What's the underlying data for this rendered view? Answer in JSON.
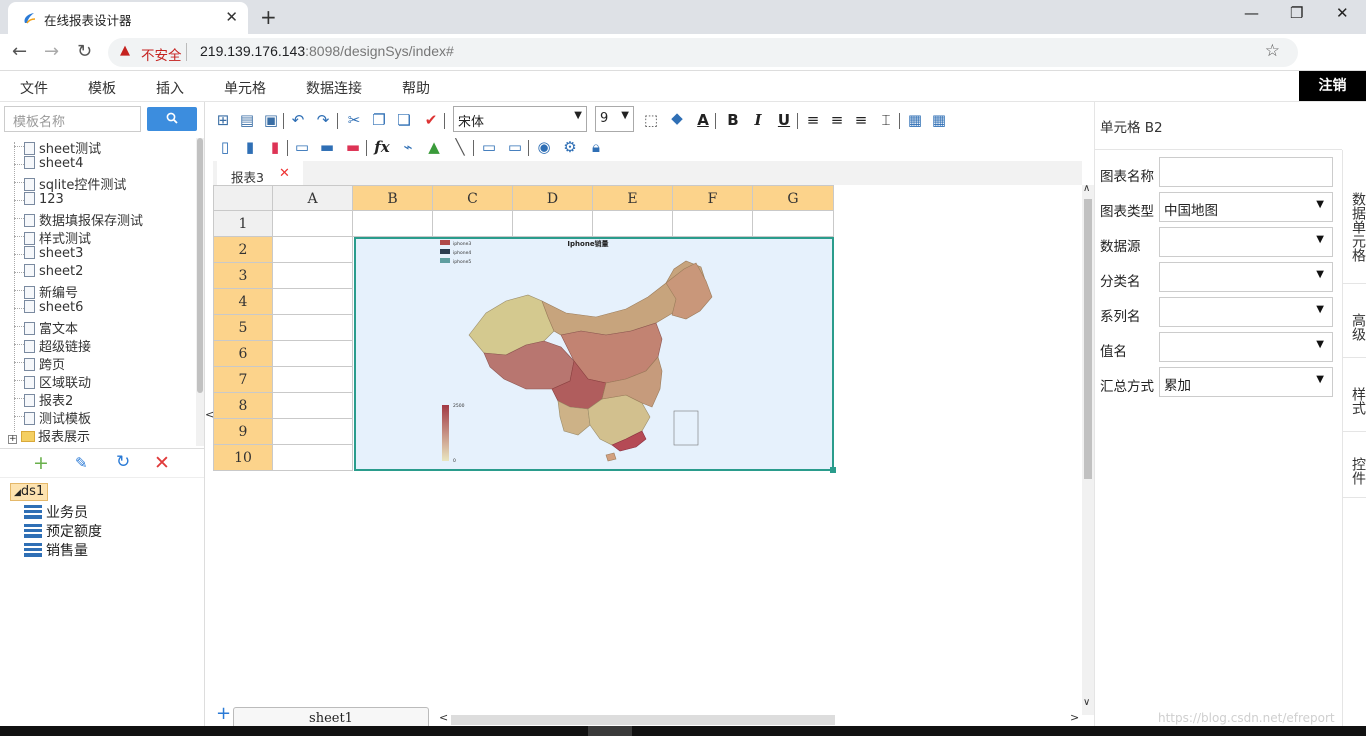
{
  "browser": {
    "tab_title": "在线报表设计器",
    "new_tab": "+",
    "insecure_label": "不安全",
    "url_host": "219.139.176.143",
    "url_rest": ":8098/designSys/index#"
  },
  "menu": {
    "items": [
      "文件",
      "模板",
      "插入",
      "单元格",
      "数据连接",
      "帮助"
    ],
    "logout": "注销"
  },
  "left": {
    "search_placeholder": "模板名称",
    "templates": [
      "sheet测试",
      "sheet4",
      "sqlite控件测试",
      "123",
      "数据填报保存测试",
      "样式测试",
      "sheet3",
      "sheet2",
      "新编号",
      "sheet6",
      "富文本",
      "超级链接",
      "跨页",
      "区域联动",
      "报表2",
      "测试模板"
    ],
    "folder": "报表展示",
    "dataset": "ds1",
    "fields": [
      "业务员",
      "预定额度",
      "销售量"
    ]
  },
  "toolbar": {
    "font": "宋体",
    "size": "9"
  },
  "sheet": {
    "active_tab": "报表3",
    "columns": [
      "A",
      "B",
      "C",
      "D",
      "E",
      "F",
      "G"
    ],
    "rows": [
      "1",
      "2",
      "3",
      "4",
      "5",
      "6",
      "7",
      "8",
      "9",
      "10"
    ],
    "bottom_tab": "sheet1"
  },
  "chart_preview": {
    "title": "Iphone销量",
    "legend": [
      "iphone3",
      "iphone4",
      "iphone5"
    ],
    "scale_max": "2500",
    "scale_min": "0"
  },
  "right": {
    "cell_title": "单元格 B2",
    "labels": {
      "chart_name": "图表名称",
      "chart_type": "图表类型",
      "datasource": "数据源",
      "category": "分类名",
      "series": "系列名",
      "value": "值名",
      "aggregate": "汇总方式"
    },
    "values": {
      "chart_name": "",
      "chart_type": "中国地图",
      "datasource": "",
      "category": "",
      "series": "",
      "value": "",
      "aggregate": "累加"
    },
    "tabs": [
      "数据单元格",
      "高级",
      "样式",
      "控件"
    ]
  },
  "watermark": "https://blog.csdn.net/efreport"
}
